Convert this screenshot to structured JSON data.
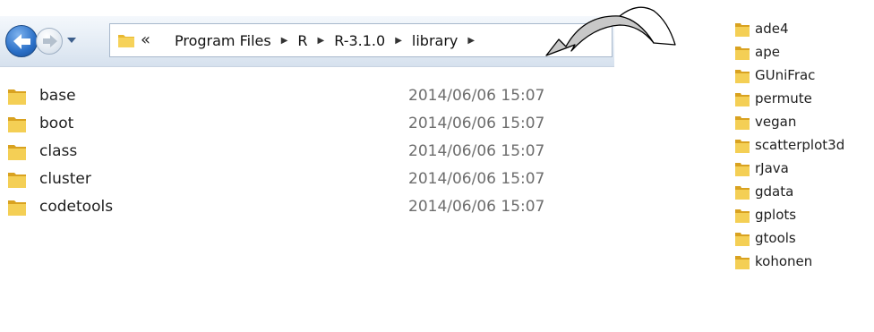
{
  "address_bar": {
    "overflow_glyph": "«",
    "breadcrumbs": [
      "Program Files",
      "R",
      "R-3.1.0",
      "library"
    ]
  },
  "files": [
    {
      "name": "base",
      "modified": "2014/06/06 15:07"
    },
    {
      "name": "boot",
      "modified": "2014/06/06 15:07"
    },
    {
      "name": "class",
      "modified": "2014/06/06 15:07"
    },
    {
      "name": "cluster",
      "modified": "2014/06/06 15:07"
    },
    {
      "name": "codetools",
      "modified": "2014/06/06 15:07"
    }
  ],
  "packages": [
    "ade4",
    "ape",
    "GUniFrac",
    "permute",
    "vegan",
    "scatterplot3d",
    "rJava",
    "gdata",
    "gplots",
    "gtools",
    "kohonen"
  ],
  "icons": {
    "back": "back-arrow-icon",
    "forward": "forward-arrow-icon",
    "history": "chevron-down-icon",
    "folder": "folder-icon",
    "separator": "chevron-right-icon",
    "callout": "curved-arrow-icon"
  },
  "colors": {
    "accent": "#2a6fc7",
    "folder": "#e8b830",
    "date_text": "#6d6d6d",
    "arrow_fill": "#c8c8c8"
  }
}
